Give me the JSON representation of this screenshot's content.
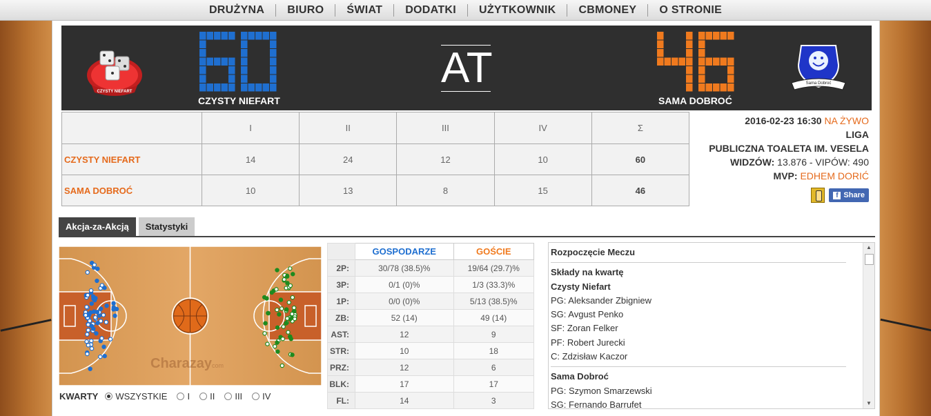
{
  "nav": [
    "DRUŻYNA",
    "BIURO",
    "ŚWIAT",
    "DODATKI",
    "UŻYTKOWNIK",
    "CBMONEY",
    "O STRONIE"
  ],
  "scoreboard": {
    "home": {
      "name": "CZYSTY NIEFART",
      "score": "60",
      "logo_text": "CZYSTY NIEFART",
      "color": "#1f6fd0"
    },
    "away": {
      "name": "SAMA DOBROĆ",
      "score": "46",
      "logo_text": "Sama Dobroć",
      "color": "#f07a1e"
    },
    "center": "AT"
  },
  "quarters_table": {
    "headers": [
      "",
      "I",
      "II",
      "III",
      "IV",
      "Σ"
    ],
    "rows": [
      {
        "team": "CZYSTY NIEFART",
        "q": [
          "14",
          "24",
          "12",
          "10"
        ],
        "total": "60"
      },
      {
        "team": "SAMA DOBROĆ",
        "q": [
          "10",
          "13",
          "8",
          "15"
        ],
        "total": "46"
      }
    ]
  },
  "info": {
    "datetime": "2016-02-23 16:30",
    "live": "NA ŻYWO",
    "type": "LIGA",
    "arena": "PUBLICZNA TOALETA IM. VESELA",
    "attendance_label": "WIDZÓW:",
    "attendance": "13.876 - VIPÓW: 490",
    "mvp_label": "MVP:",
    "mvp": "EDHEM DORIĆ",
    "share": "Share"
  },
  "tabs": [
    "Akcja-za-Akcją",
    "Statystyki"
  ],
  "court": {
    "watermark": "Charazay",
    "watermark_suffix": "com"
  },
  "quarter_filter": {
    "label": "KWARTY",
    "options": [
      "WSZYSTKIE",
      "I",
      "II",
      "III",
      "IV"
    ],
    "selected": "WSZYSTKIE"
  },
  "stats": {
    "home_header": "GOSPODARZE",
    "away_header": "GOŚCIE",
    "rows": [
      {
        "label": "2P:",
        "home": "30/78 (38.5)%",
        "away": "19/64 (29.7)%"
      },
      {
        "label": "3P:",
        "home": "0/1 (0)%",
        "away": "1/3 (33.3)%"
      },
      {
        "label": "1P:",
        "home": "0/0 (0)%",
        "away": "5/13 (38.5)%"
      },
      {
        "label": "ZB:",
        "home": "52 (14)",
        "away": "49 (14)"
      },
      {
        "label": "AST:",
        "home": "12",
        "away": "9"
      },
      {
        "label": "STR:",
        "home": "10",
        "away": "18"
      },
      {
        "label": "PRZ:",
        "home": "12",
        "away": "6"
      },
      {
        "label": "BLK:",
        "home": "17",
        "away": "17"
      },
      {
        "label": "FL:",
        "home": "14",
        "away": "3"
      }
    ]
  },
  "pbp": {
    "title": "Rozpoczęcie Meczu",
    "lineups_title": "Składy na kwartę",
    "teams": [
      {
        "name": "Czysty Niefart",
        "players": [
          "PG: Aleksander Zbigniew",
          "SG: Avgust Penko",
          "SF: Zoran Felker",
          "PF: Robert Jurecki",
          "C: Zdzisław Kaczor"
        ]
      },
      {
        "name": "Sama Dobroć",
        "players": [
          "PG: Szymon Smarzewski",
          "SG: Fernando Barrufet"
        ]
      }
    ]
  }
}
